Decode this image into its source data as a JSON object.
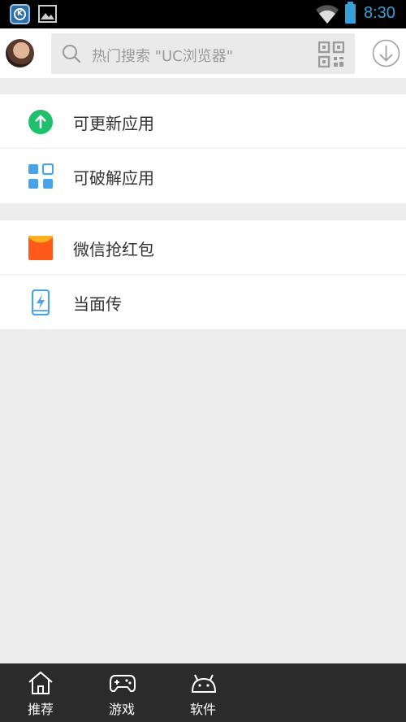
{
  "status_bar": {
    "time": "8:30",
    "app_icon": "k-app-icon",
    "gallery_icon": "image-icon",
    "wifi_icon": "wifi-icon",
    "battery_icon": "battery-icon",
    "accent_color": "#37a0d6"
  },
  "top_bar": {
    "avatar": "user-avatar",
    "search": {
      "placeholder": "热门搜索 \"UC浏览器\"",
      "search_icon": "search-icon",
      "scan_icon": "qr-code-icon"
    },
    "download_icon": "download-icon"
  },
  "menu_groups": [
    {
      "items": [
        {
          "label": "可更新应用",
          "icon": "arrow-up-circle-icon",
          "color": "#1fbf6b"
        },
        {
          "label": "可破解应用",
          "icon": "grid-apps-icon",
          "color": "#4aa3ea"
        }
      ]
    },
    {
      "items": [
        {
          "label": "微信抢红包",
          "icon": "red-envelope-icon",
          "color": "#ff5a1a"
        },
        {
          "label": "当面传",
          "icon": "phone-transfer-icon",
          "color": "#4aa3ea"
        }
      ]
    }
  ],
  "bottom_nav": {
    "items": [
      {
        "label": "推荐",
        "icon": "home-icon"
      },
      {
        "label": "游戏",
        "icon": "gamepad-icon"
      },
      {
        "label": "软件",
        "icon": "android-icon"
      }
    ]
  }
}
